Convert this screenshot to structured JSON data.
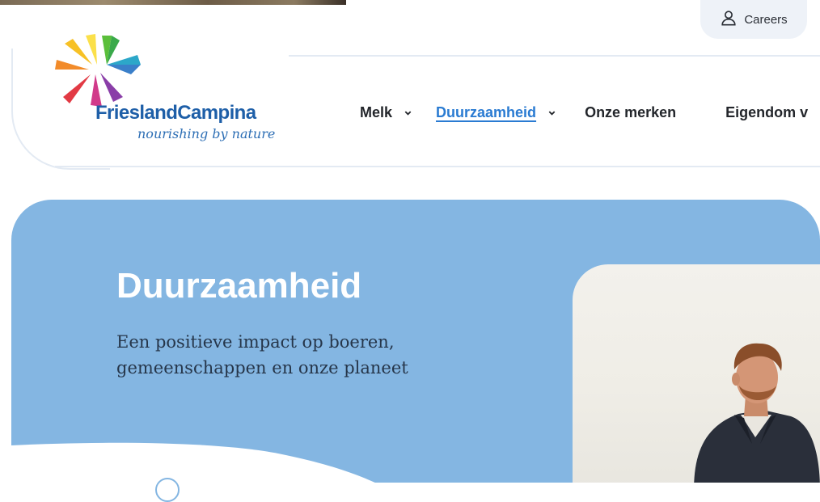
{
  "header": {
    "careers_label": "Careers",
    "logo": {
      "wordmark": "FrieslandCampina",
      "tagline": "nourishing by nature"
    },
    "nav": [
      {
        "label": "Melk",
        "has_dropdown": true,
        "active": false
      },
      {
        "label": "Duurzaamheid",
        "has_dropdown": true,
        "active": true
      },
      {
        "label": "Onze merken",
        "has_dropdown": false,
        "active": false
      },
      {
        "label": "Eigendom v",
        "has_dropdown": false,
        "active": false
      }
    ]
  },
  "hero": {
    "title": "Duurzaamheid",
    "subtitle_line1": "Een positieve impact op boeren,",
    "subtitle_line2": "gemeenschappen en onze planeet"
  },
  "colors": {
    "brand_blue": "#1e5fa8",
    "nav_active": "#2a7bd2",
    "hero_bg": "#84b6e2",
    "careers_bg": "#eef2f8"
  },
  "icons": {
    "careers": "user-icon",
    "dropdown": "chevron-down-icon"
  }
}
